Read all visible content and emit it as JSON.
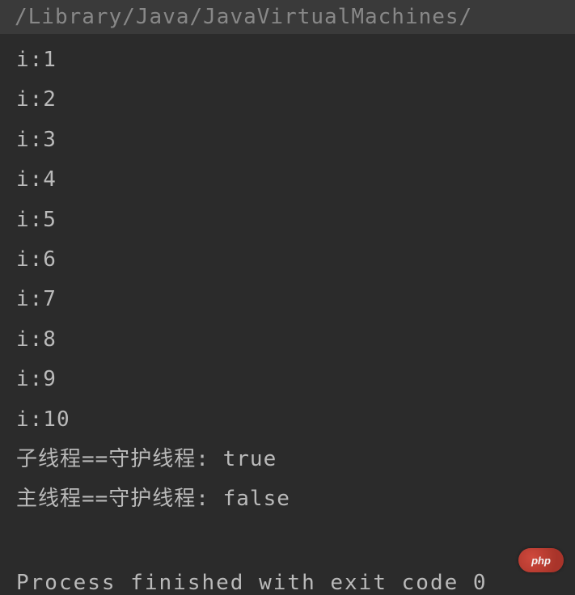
{
  "path_bar": "/Library/Java/JavaVirtualMachines/",
  "output_lines": [
    "i:1",
    "i:2",
    "i:3",
    "i:4",
    "i:5",
    "i:6",
    "i:7",
    "i:8",
    "i:9",
    "i:10",
    "子线程==守护线程: true",
    "主线程==守护线程: false"
  ],
  "exit_message": "Process finished with exit code 0",
  "watermark": "php"
}
